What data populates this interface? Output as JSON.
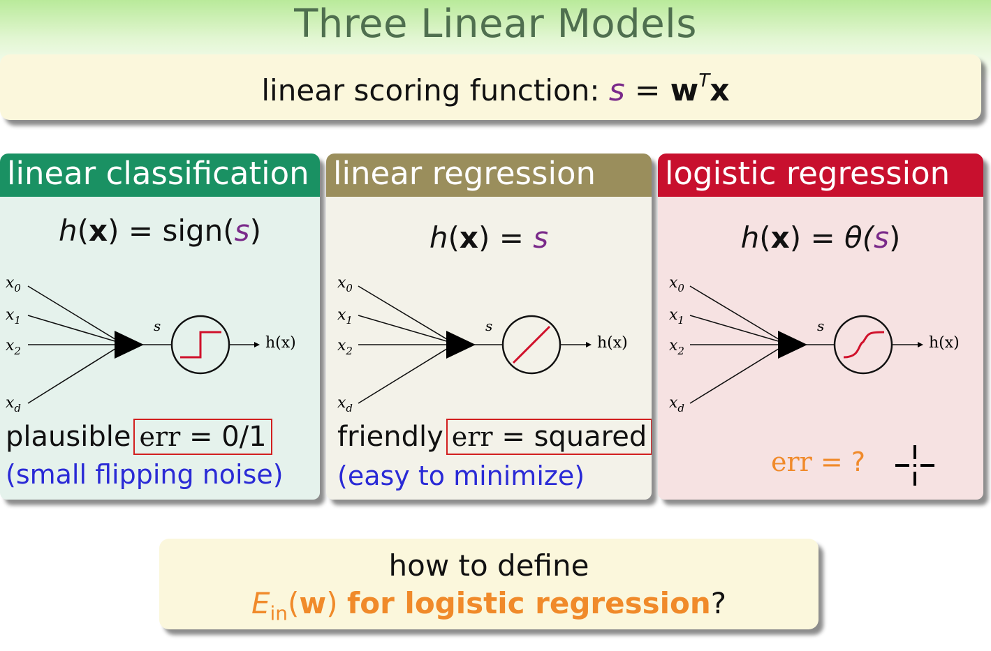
{
  "title": "Three Linear Models",
  "scoring": {
    "label": "linear scoring function:",
    "s": "s",
    "eq": "=",
    "w": "w",
    "T": "T",
    "x": "x"
  },
  "panels": [
    {
      "header": "linear classification",
      "hx": {
        "h": "h",
        "open": "(",
        "x": "x",
        "close": ")",
        "eq": "=",
        "fn": "sign(",
        "s": "s",
        "end": ")"
      },
      "inputs": [
        "x0",
        "x1",
        "x2",
        "xd"
      ],
      "score_label": "s",
      "output_label": "h(x)",
      "activation_icon": "step-function-icon",
      "err_prefix": "plausible",
      "err_name": "err",
      "err_eq": "=",
      "err_value": "0/1",
      "note": "(small flipping noise)"
    },
    {
      "header": "linear regression",
      "hx": {
        "h": "h",
        "open": "(",
        "x": "x",
        "close": ")",
        "eq": "=",
        "fn": "",
        "s": "s",
        "end": ""
      },
      "inputs": [
        "x0",
        "x1",
        "x2",
        "xd"
      ],
      "score_label": "s",
      "output_label": "h(x)",
      "activation_icon": "identity-function-icon",
      "err_prefix": "friendly",
      "err_name": "err",
      "err_eq": "=",
      "err_value": "squared",
      "note": "(easy to minimize)"
    },
    {
      "header": "logistic regression",
      "hx": {
        "h": "h",
        "open": "(",
        "x": "x",
        "close": ")",
        "eq": "=",
        "fn": "θ(",
        "s": "s",
        "end": ")"
      },
      "inputs": [
        "x0",
        "x1",
        "x2",
        "xd"
      ],
      "score_label": "s",
      "output_label": "h(x)",
      "activation_icon": "sigmoid-function-icon",
      "err_name": "err",
      "err_eq": "=",
      "err_value": "?"
    }
  ],
  "question": {
    "line1": "how to define",
    "E": "E",
    "sub": "in",
    "w_open": "(",
    "w": "w",
    "w_close": ")",
    "rest": "for logistic regression",
    "mark": "?"
  },
  "colors": {
    "classification": "#1a9163",
    "regression": "#9a8e5c",
    "logistic": "#c8102e",
    "accent_orange": "#f08a2a",
    "note_blue": "#2a2ad6",
    "score_purple": "#7a2a8a"
  }
}
